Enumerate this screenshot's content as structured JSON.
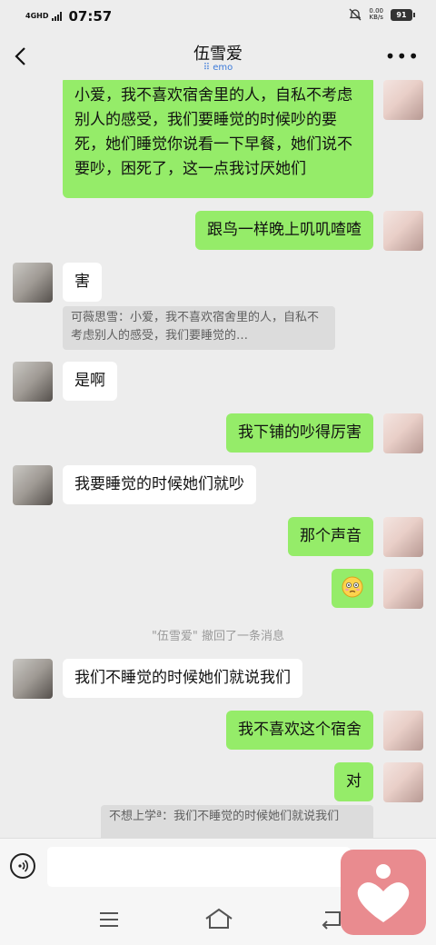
{
  "status_bar": {
    "network": "4GHD",
    "time": "07:57",
    "net_speed_value": "0.00",
    "net_speed_unit": "KB/s",
    "battery": "91"
  },
  "header": {
    "contact_name": "伍雪爱",
    "status_text": "emo"
  },
  "messages": [
    {
      "side": "right",
      "text": "小爱，我不喜欢宿舍里的人，自私不考虑别人的感受，我们要睡觉的时候吵的要死，她们睡觉你说看一下早餐，她们说不要吵，困死了，这一点我讨厌她们"
    },
    {
      "side": "right",
      "text": "跟鸟一样晚上叽叽喳喳"
    },
    {
      "side": "left",
      "text": "害",
      "quote": "可薇思雪：小爱，我不喜欢宿舍里的人，自私不考虑别人的感受，我们要睡觉的…"
    },
    {
      "side": "left",
      "text": "是啊"
    },
    {
      "side": "right",
      "text": "我下铺的吵得厉害"
    },
    {
      "side": "left",
      "text": "我要睡觉的时候她们就吵"
    },
    {
      "side": "right",
      "text": "那个声音"
    },
    {
      "side": "right",
      "emoji": "flushed-face"
    },
    {
      "side": "system",
      "text": "\"伍雪爱\" 撤回了一条消息"
    },
    {
      "side": "left",
      "text": "我们不睡觉的时候她们就说我们"
    },
    {
      "side": "right",
      "text": "我不喜欢这个宿舍"
    },
    {
      "side": "right",
      "text": "对",
      "quote": "不想上学ª：我们不睡觉的时候她们就说我们"
    }
  ],
  "icons": {
    "back": "chevron-left-icon",
    "more": "more-icon",
    "voice": "voice-icon",
    "floating": "heart-person-icon",
    "nav": [
      "menu-icon",
      "home-icon",
      "back-nav-icon"
    ]
  },
  "colors": {
    "sent_bubble": "#95ec69",
    "received_bubble": "#ffffff",
    "background": "#ededed",
    "floating_app": "#e98b8f"
  }
}
